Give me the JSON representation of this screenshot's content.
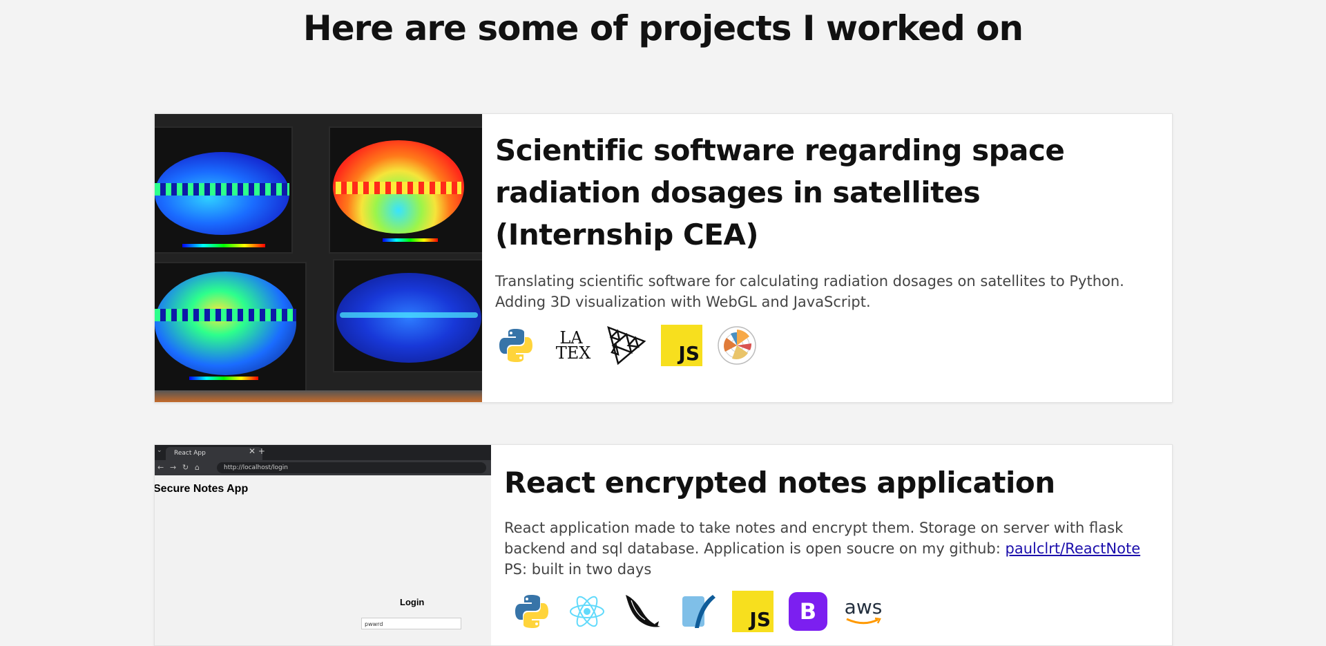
{
  "page": {
    "title": "Here are some of projects I worked on"
  },
  "projects": [
    {
      "title": "Scientific software regarding space radiation dosages in satellites (Internship CEA)",
      "description": "Translating scientific software for calculating radiation dosages on satellites to Python. Adding 3D visualization with WebGL and JavaScript.",
      "icons": [
        "python-icon",
        "latex-icon",
        "threejs-icon",
        "javascript-icon",
        "matplotlib-icon"
      ]
    },
    {
      "title": "React encrypted notes application",
      "description_before_link": "React application made to take notes and encrypt them. Storage on server with flask backend and sql database. Application is open soucre on my github: ",
      "link_text": "paulclrt/ReactNote",
      "note": "PS: built in two days",
      "icons": [
        "python-icon",
        "react-icon",
        "flask-icon",
        "sqlite-icon",
        "javascript-icon",
        "bootstrap-icon",
        "aws-icon"
      ],
      "screenshot": {
        "tab_label": "React App",
        "url": "http://localhost/login",
        "app_title": "Secure Notes App",
        "login_label": "Login",
        "password_value": "pwwrd"
      }
    }
  ],
  "icon_text": {
    "latex_top": "LA",
    "latex_bottom": "TEX",
    "js": "JS",
    "bootstrap": "B",
    "aws": "aws"
  },
  "colors": {
    "background": "#f3f3f3",
    "card": "#ffffff",
    "link": "#1a0dab",
    "js_yellow": "#f7df1e",
    "bootstrap_purple": "#7c1ff0",
    "react_cyan": "#61dafb"
  }
}
